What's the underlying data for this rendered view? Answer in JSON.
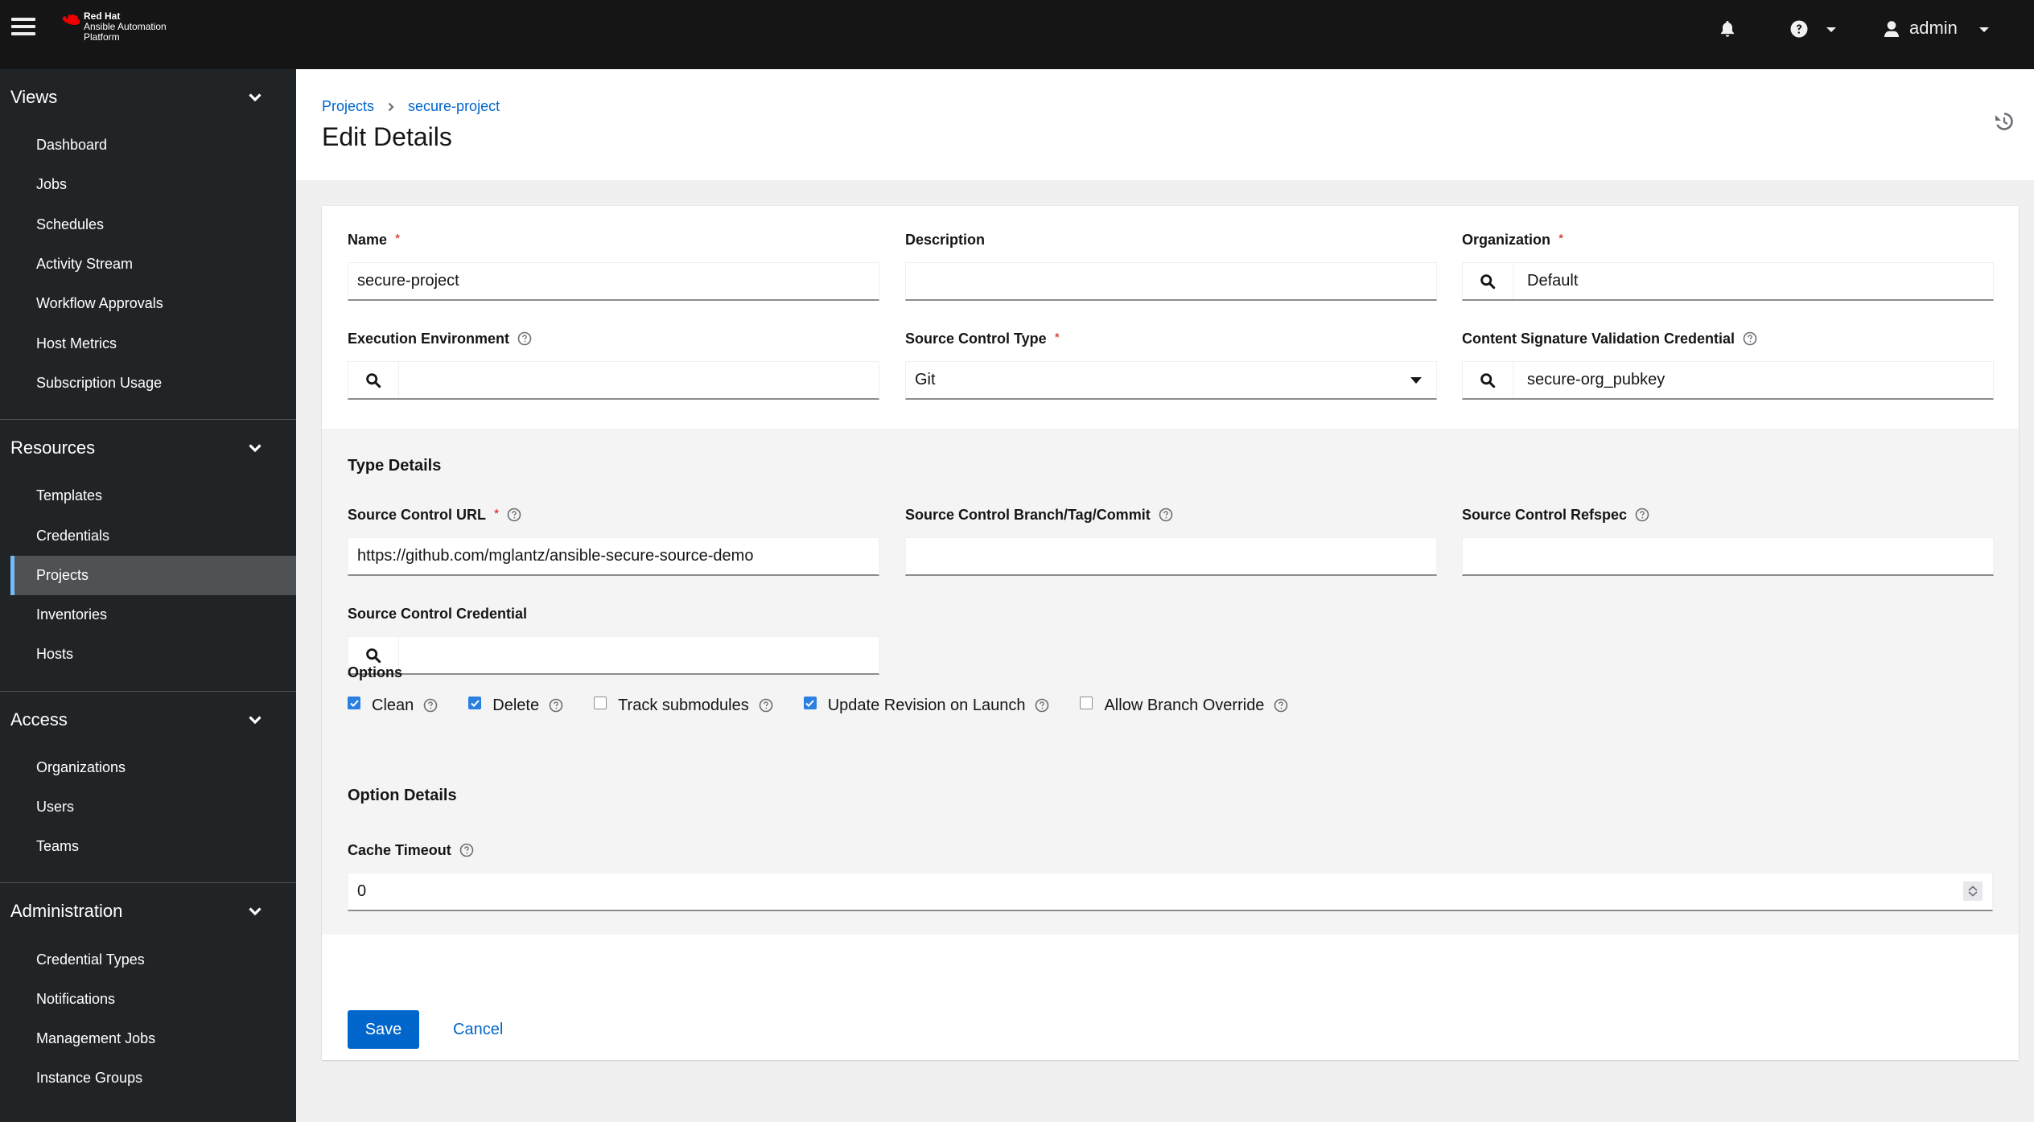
{
  "masthead": {
    "brand_line1": "Red Hat",
    "brand_line2": "Ansible Automation",
    "brand_line3": "Platform",
    "username": "admin"
  },
  "sidebar": {
    "groups": [
      {
        "title": "Views",
        "items": [
          "Dashboard",
          "Jobs",
          "Schedules",
          "Activity Stream",
          "Workflow Approvals",
          "Host Metrics",
          "Subscription Usage"
        ]
      },
      {
        "title": "Resources",
        "items": [
          "Templates",
          "Credentials",
          "Projects",
          "Inventories",
          "Hosts"
        ]
      },
      {
        "title": "Access",
        "items": [
          "Organizations",
          "Users",
          "Teams"
        ]
      },
      {
        "title": "Administration",
        "items": [
          "Credential Types",
          "Notifications",
          "Management Jobs",
          "Instance Groups"
        ]
      }
    ],
    "active_item": "Projects"
  },
  "breadcrumb": {
    "root": "Projects",
    "current": "secure-project"
  },
  "page_title": "Edit Details",
  "form": {
    "name": {
      "label": "Name",
      "value": "secure-project",
      "required": true
    },
    "description": {
      "label": "Description",
      "value": ""
    },
    "organization": {
      "label": "Organization",
      "value": "Default",
      "required": true
    },
    "execution_environment": {
      "label": "Execution Environment",
      "value": ""
    },
    "source_control_type": {
      "label": "Source Control Type",
      "value": "Git",
      "required": true
    },
    "content_signature": {
      "label": "Content Signature Validation Credential",
      "value": "secure-org_pubkey"
    },
    "type_details_title": "Type Details",
    "source_control_url": {
      "label": "Source Control URL",
      "value": "https://github.com/mglantz/ansible-secure-source-demo",
      "required": true
    },
    "source_control_branch": {
      "label": "Source Control Branch/Tag/Commit",
      "value": ""
    },
    "source_control_refspec": {
      "label": "Source Control Refspec",
      "value": ""
    },
    "source_control_credential": {
      "label": "Source Control Credential",
      "value": ""
    },
    "options_title": "Options",
    "options": [
      {
        "label": "Clean",
        "checked": true
      },
      {
        "label": "Delete",
        "checked": true
      },
      {
        "label": "Track submodules",
        "checked": false
      },
      {
        "label": "Update Revision on Launch",
        "checked": true
      },
      {
        "label": "Allow Branch Override",
        "checked": false
      }
    ],
    "option_details_title": "Option Details",
    "cache_timeout": {
      "label": "Cache Timeout",
      "value": "0"
    },
    "required_marker": "*"
  },
  "actions": {
    "save": "Save",
    "cancel": "Cancel"
  },
  "colors": {
    "primary": "#0066cc",
    "masthead": "#151515",
    "sidebar": "#212427",
    "active_indicator": "#73bcf7",
    "required": "#c9190b",
    "checkbox": "#2b7fe0"
  }
}
